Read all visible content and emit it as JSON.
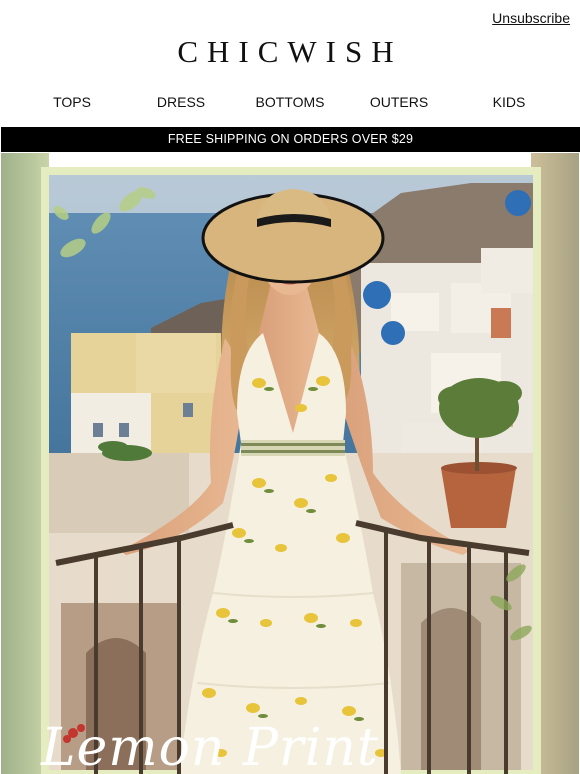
{
  "header": {
    "unsubscribe_label": "Unsubscribe",
    "brand": "CHICWISH"
  },
  "nav": {
    "items": [
      {
        "label": "TOPS"
      },
      {
        "label": "DRESS"
      },
      {
        "label": "BOTTOMS"
      },
      {
        "label": "OUTERS"
      },
      {
        "label": "KIDS"
      }
    ]
  },
  "promo_banner": {
    "text": "FREE SHIPPING ON ORDERS OVER $29"
  },
  "hero": {
    "overlay_text": "Lemon Print",
    "colors": {
      "frame": "#e4ecc0",
      "sea": "#5c88ad",
      "dress": "#f5f0e0",
      "lemon": "#e8c43a",
      "leaf": "#6f8d3a",
      "hat": "#d7b57c"
    }
  }
}
